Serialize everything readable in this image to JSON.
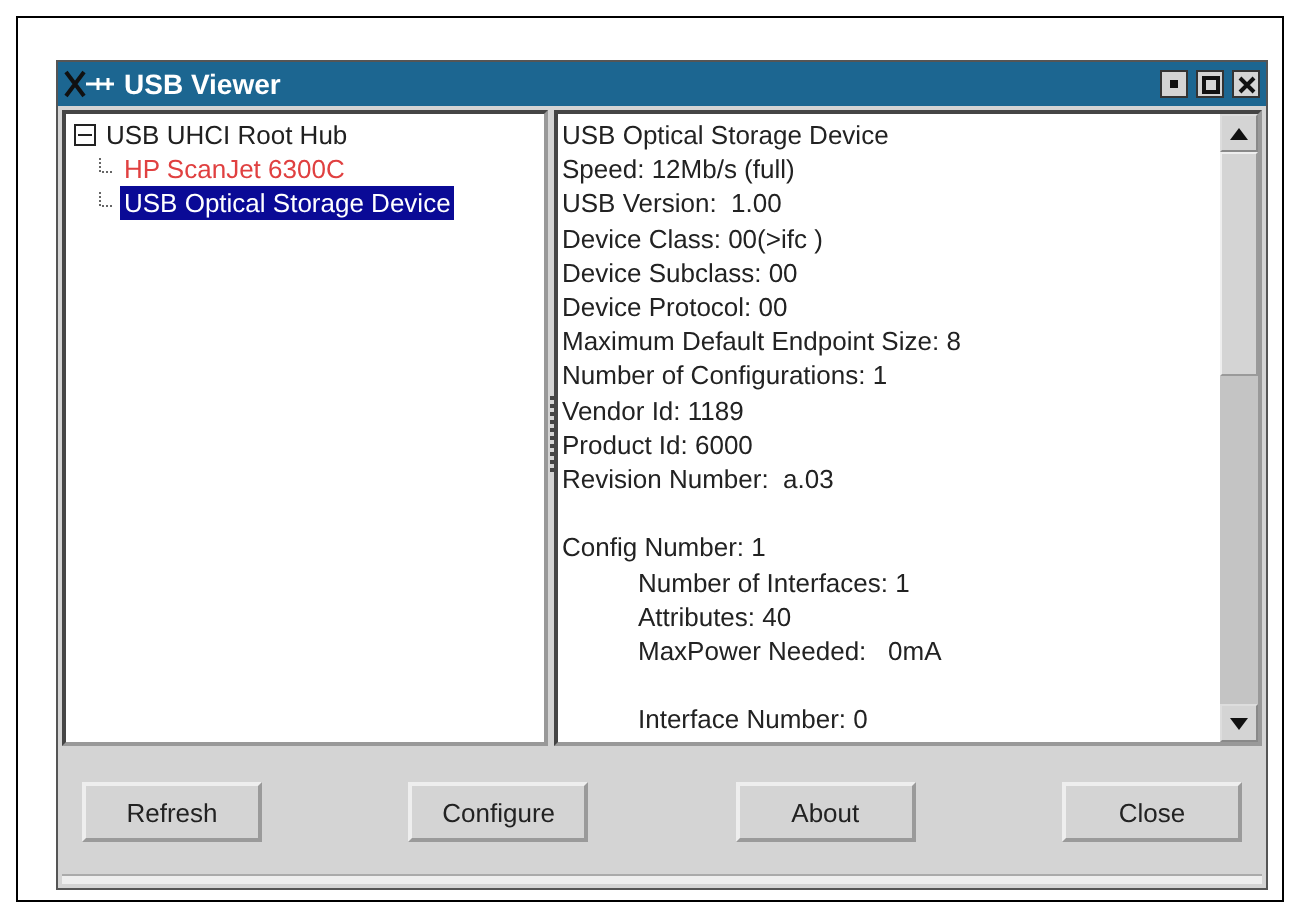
{
  "window": {
    "title": "USB Viewer"
  },
  "tree": [
    {
      "label": "USB UHCI Root Hub",
      "selected": false,
      "expanded": true,
      "color": "#202020",
      "children": [
        {
          "label": "HP ScanJet 6300C",
          "selected": false,
          "color": "#e04040"
        },
        {
          "label": "USB Optical Storage Device",
          "selected": true
        }
      ]
    }
  ],
  "details": [
    {
      "kind": "line",
      "text": "USB Optical Storage Device"
    },
    {
      "kind": "line",
      "text": "Speed: 12Mb/s (full)"
    },
    {
      "kind": "line",
      "text": "USB Version:  1.00"
    },
    {
      "kind": "line",
      "text": "Device Class: 00(>ifc )"
    },
    {
      "kind": "line",
      "text": "Device Subclass: 00"
    },
    {
      "kind": "line",
      "text": "Device Protocol: 00"
    },
    {
      "kind": "line",
      "text": "Maximum Default Endpoint Size: 8"
    },
    {
      "kind": "line",
      "text": "Number of Configurations: 1"
    },
    {
      "kind": "line",
      "text": "Vendor Id: 1189"
    },
    {
      "kind": "line",
      "text": "Product Id: 6000"
    },
    {
      "kind": "line",
      "text": "Revision Number:  a.03"
    },
    {
      "kind": "section",
      "text": "Config Number: 1",
      "children": [
        {
          "kind": "line",
          "text": "Number of Interfaces: 1"
        },
        {
          "kind": "line",
          "text": "Attributes: 40"
        },
        {
          "kind": "line",
          "text": "MaxPower Needed:   0mA"
        },
        {
          "kind": "section",
          "text": "Interface Number: 0"
        }
      ]
    }
  ],
  "buttons": [
    "Refresh",
    "Configure",
    "About",
    "Close"
  ]
}
